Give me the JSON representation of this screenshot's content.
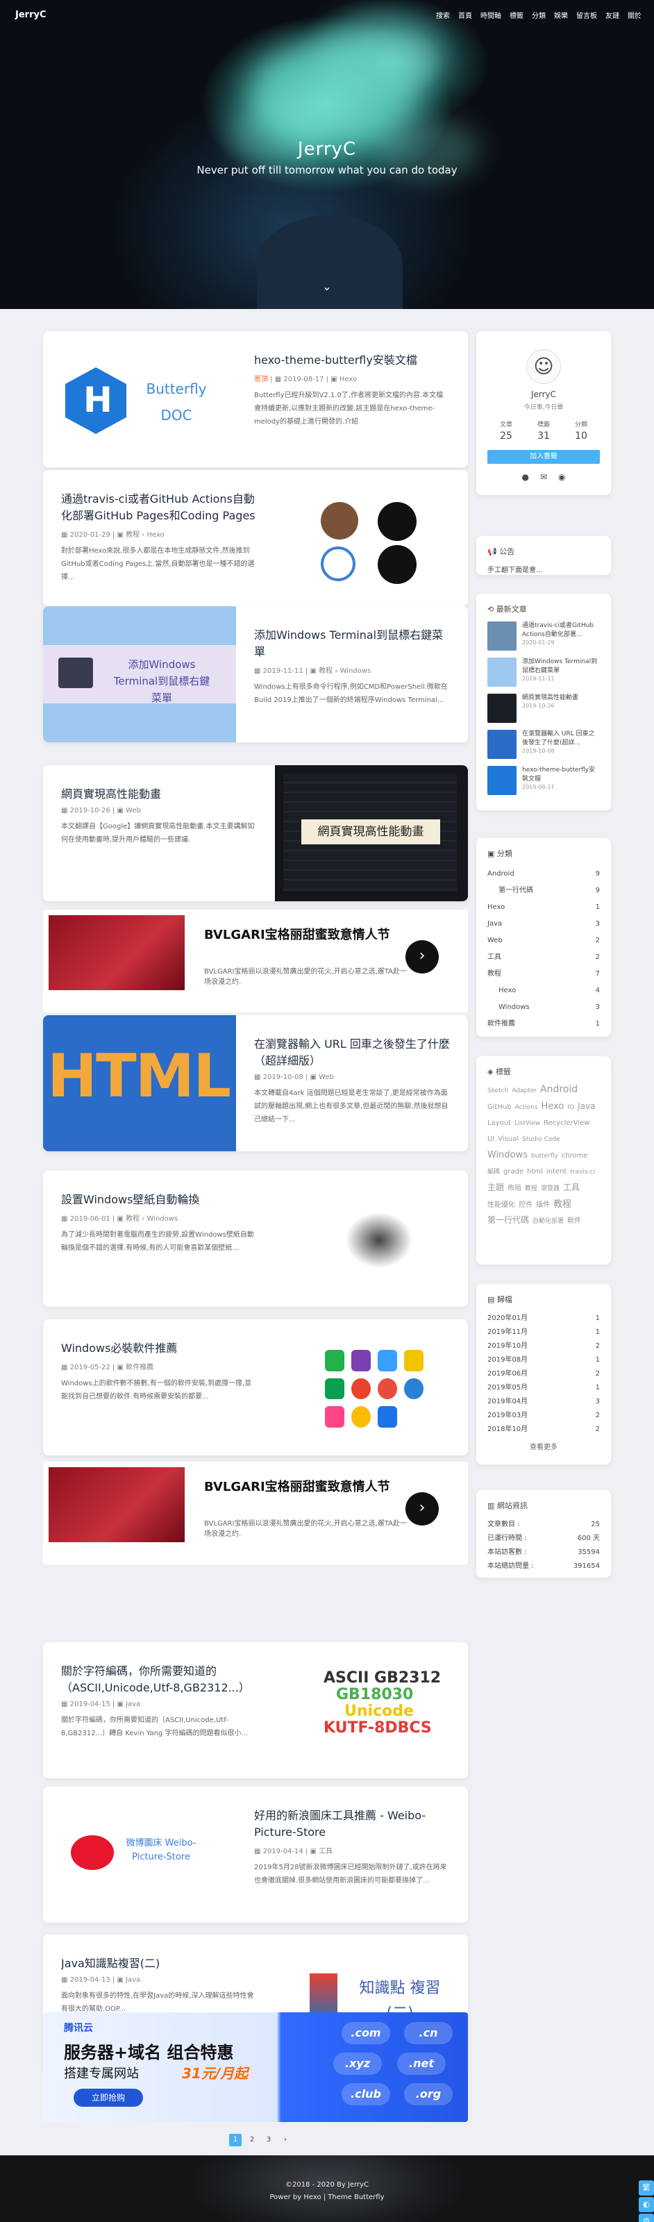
{
  "site": {
    "logo": "JerryC",
    "title": "JerryC",
    "subtitle": "Never put off till tomorrow what you can do today"
  },
  "menu": [
    "搜索",
    "首頁",
    "時間軸",
    "標籤",
    "分類",
    "娛樂",
    "留言板",
    "友鏈",
    "關於"
  ],
  "posts": [
    {
      "title": "hexo-theme-butterfly安裝文檔",
      "sticky": "置頂",
      "date": "2019-08-17",
      "cat": "Hexo",
      "excerpt": "Butterfly已經升級到V2.1.0了,作者將更新文檔的內容.本文檔會持續更新,以應對主題新的改變.該主題是在hexo-theme-melody的基礎上進行開發的.介紹",
      "thumb_text": "Butterfly DOC"
    },
    {
      "title": "通過travis-ci或者GitHub Actions自動化部署GitHub Pages和Coding Pages",
      "date": "2020-01-29",
      "cat": "教程",
      "sub": "Hexo",
      "excerpt": "對於部署Hexo來說,很多人都是在本地生成靜態文件,然後推到GitHub或者Coding Pages上.當然,自動部署也是一種不錯的選擇..."
    },
    {
      "title": "添加Windows Terminal到鼠標右鍵菜單",
      "date": "2019-11-11",
      "cat": "教程",
      "sub": "Windows",
      "excerpt": "Windows上有很多命令行程序,例如CMD和PowerShell.微軟在Build 2019上推出了一個新的終端程序Windows Terminal...",
      "thumb_text": "添加Windows Terminal到鼠標右鍵菜單"
    },
    {
      "title": "網頁實現高性能動畫",
      "date": "2019-10-26",
      "cat": "Web",
      "excerpt": "本文翻譯自【Google】讓網頁實現高性能動畫.本文主要講解如何在使用動畫時,提升用戶體驗的一些建議.",
      "thumb_text": "網頁實現高性能動畫"
    },
    {
      "title": "在瀏覽器輸入 URL 回車之後發生了什麼（超詳細版）",
      "date": "2019-10-08",
      "cat": "Web",
      "excerpt": "本文轉載自4ark 這個問題已經是老生常談了,更是經常被作為面試的壓軸題出現,網上也有很多文章,但最近閒的無聊,然後就想自己總結一下..."
    },
    {
      "title": "設置Windows壁紙自動輪換",
      "date": "2019-06-01",
      "cat": "教程",
      "sub": "Windows",
      "excerpt": "為了減少長時間對著電腦而產生的疲勞,設置Windows壁紙自動輪換是個不錯的選擇.有時候,有的人可能會喜歡某個壁紙..."
    },
    {
      "title": "Windows必裝軟件推薦",
      "date": "2019-05-22",
      "cat": "軟件推薦",
      "excerpt": "Windows上的軟件數不勝數,有一個的軟件安裝,到處搜一搜,並能找到自己想要的軟件.有時候需要安裝的都要..."
    },
    {
      "title": "關於字符編碼，你所需要知道的（ASCII,Unicode,Utf-8,GB2312...）",
      "date": "2019-04-15",
      "cat": "Java",
      "excerpt": "關於字符編碼，你所需要知道的（ASCII,Unicode,Utf-8,GB2312...）轉自 Kevin Yang 字符編碼的問題看似很小..."
    },
    {
      "title": "好用的新浪圖床工具推薦 - Weibo-Picture-Store",
      "date": "2019-04-14",
      "cat": "工具",
      "excerpt": "2019年5月28號新浪微博圖床已經開始限制外鏈了,或許在將來也會徹底關掉.很多網站使用新浪圖床的可能都要換掉了...",
      "thumb_text": "微博圖床 Weibo-Picture-Store"
    },
    {
      "title": "Java知識點複習(二)",
      "date": "2019-04-13",
      "cat": "Java",
      "excerpt": "面向對象有很多的特性,在學習Java的時候,深入理解這些特性會有很大的幫助.OOP...",
      "thumb_text": "知識點 複習(二)"
    }
  ],
  "ads": [
    {
      "title": "BVLGARI宝格丽甜蜜致意情人节",
      "desc": "BVLGARI宝格丽以浪漫礼赞廣出愛的花火,开启心意之选,邂TA赴一场浪漫之约."
    },
    {
      "title": "BVLGARI宝格丽甜蜜致意情人节",
      "desc": "BVLGARI宝格丽以浪漫礼赞廣出愛的花火,开启心意之选,邂TA赴一场浪漫之约."
    }
  ],
  "tencent": {
    "brand": "腾讯云",
    "line1": "服务器+域名  组合特惠",
    "line2": "搭建专属网站",
    "price": "31元/月起",
    "btn": "立即抢购",
    "domains": [
      ".com",
      ".cn",
      ".xyz",
      ".net",
      ".club",
      ".org"
    ]
  },
  "author": {
    "name": "JerryC",
    "desc": "今日事,今日畢",
    "stats": [
      {
        "k": "文章",
        "v": "25"
      },
      {
        "k": "標籤",
        "v": "31"
      },
      {
        "k": "分類",
        "v": "10"
      }
    ],
    "follow": "加入書籤"
  },
  "announcement": {
    "title": "公告",
    "text": "手工翻下面是會..."
  },
  "recent": {
    "title": "最新文章",
    "items": [
      {
        "t": "通過travis-ci或者GitHub Actions自動化部署...",
        "d": "2020-01-29"
      },
      {
        "t": "添加Windows Terminal到鼠標右鍵菜單",
        "d": "2019-11-11"
      },
      {
        "t": "網頁實現高性能動畫",
        "d": "2019-10-26"
      },
      {
        "t": "在瀏覽器輸入 URL 回車之後發生了什麼(超詳...",
        "d": "2019-10-08"
      },
      {
        "t": "hexo-theme-butterfly安裝文檔",
        "d": "2019-08-17"
      }
    ]
  },
  "categories": {
    "title": "分類",
    "items": [
      {
        "n": "Android",
        "c": "9",
        "sub": false
      },
      {
        "n": "第一行代碼",
        "c": "9",
        "sub": true
      },
      {
        "n": "Hexo",
        "c": "1",
        "sub": false
      },
      {
        "n": "Java",
        "c": "3",
        "sub": false
      },
      {
        "n": "Web",
        "c": "2",
        "sub": false
      },
      {
        "n": "工具",
        "c": "2",
        "sub": false
      },
      {
        "n": "教程",
        "c": "7",
        "sub": false
      },
      {
        "n": "Hexo",
        "c": "4",
        "sub": true
      },
      {
        "n": "Windows",
        "c": "3",
        "sub": true
      },
      {
        "n": "軟件推薦",
        "c": "1",
        "sub": false
      }
    ]
  },
  "tags": {
    "title": "標籤",
    "items": [
      "Sketch",
      "Adapter",
      "Android",
      "GitHub",
      "Actions",
      "Hexo",
      "IO",
      "Java",
      "Layout",
      "ListView",
      "RecyclerView",
      "UI",
      "Visual",
      "Studio Code",
      "Windows",
      "butterfly",
      "chrome",
      "編碼",
      "grade",
      "html",
      "intent",
      "travis-ci",
      "主題",
      "佈局",
      "教程",
      "瀏覽器",
      "工具",
      "性能優化",
      "控件",
      "插件",
      "教程",
      "第一行代碼",
      "自動化部署",
      "軟件"
    ]
  },
  "archives": {
    "title": "歸檔",
    "items": [
      {
        "m": "2020年01月",
        "c": "1"
      },
      {
        "m": "2019年11月",
        "c": "1"
      },
      {
        "m": "2019年10月",
        "c": "2"
      },
      {
        "m": "2019年08月",
        "c": "1"
      },
      {
        "m": "2019年06月",
        "c": "2"
      },
      {
        "m": "2019年05月",
        "c": "1"
      },
      {
        "m": "2019年04月",
        "c": "3"
      },
      {
        "m": "2019年03月",
        "c": "2"
      },
      {
        "m": "2018年10月",
        "c": "2"
      }
    ],
    "more": "查看更多"
  },
  "webinfo": {
    "title": "網站資訊",
    "items": [
      {
        "k": "文章數目 :",
        "v": "25"
      },
      {
        "k": "已運行時間 :",
        "v": "600 天"
      },
      {
        "k": "本站訪客數 :",
        "v": "35594"
      },
      {
        "k": "本站總訪問量 :",
        "v": "391654"
      }
    ]
  },
  "pager": [
    "1",
    "2",
    "3"
  ],
  "footer": {
    "copy": "©2018 - 2020 By JerryC",
    "powered": "Power by Hexo | Theme Butterfly"
  }
}
